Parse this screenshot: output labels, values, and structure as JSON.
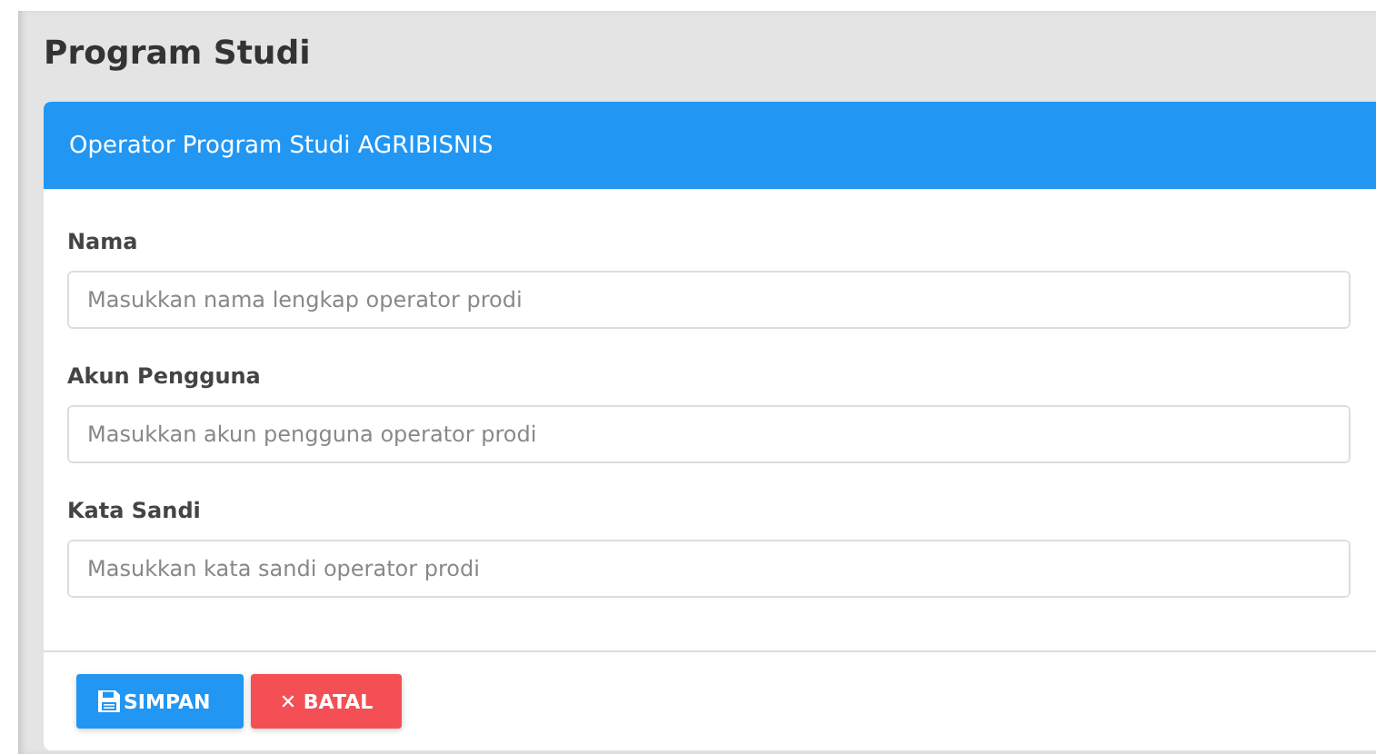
{
  "page_title": "Program Studi",
  "card": {
    "title": "Operator Program Studi AGRIBISNIS",
    "fields": [
      {
        "label": "Nama",
        "placeholder": "Masukkan nama lengkap operator prodi"
      },
      {
        "label": "Akun Pengguna",
        "placeholder": "Masukkan akun pengguna operator prodi"
      },
      {
        "label": "Kata Sandi",
        "placeholder": "Masukkan kata sandi operator prodi"
      }
    ],
    "buttons": [
      {
        "kind": "save",
        "label": "SIMPAN"
      },
      {
        "kind": "cancel",
        "label": "✕ BATAL"
      }
    ]
  }
}
